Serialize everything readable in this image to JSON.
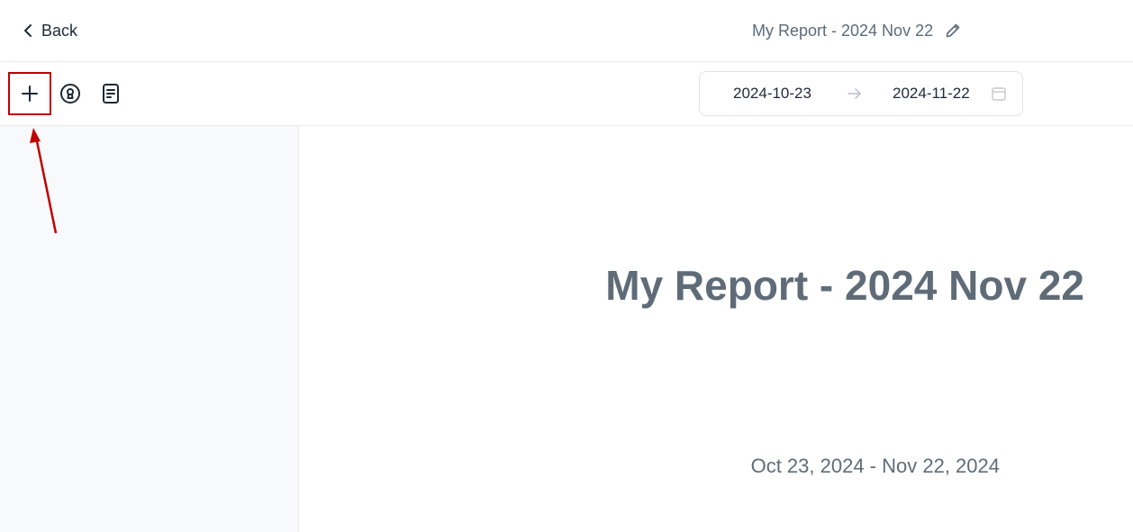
{
  "header": {
    "back_label": "Back",
    "report_title": "My Report - 2024 Nov 22"
  },
  "toolbar": {
    "tools": [
      {
        "name": "add",
        "icon": "plus-icon"
      },
      {
        "name": "lock",
        "icon": "keyhole-circle-icon"
      },
      {
        "name": "doc",
        "icon": "document-icon"
      }
    ],
    "date_start": "2024-10-23",
    "date_end": "2024-11-22",
    "range_arrow_icon": "arrow-right-icon",
    "calendar_icon": "calendar-icon"
  },
  "report": {
    "title": "My Report - 2024 Nov 22",
    "date_range": "Oct 23, 2024 - Nov 22, 2024"
  },
  "colors": {
    "highlight": "#c00000",
    "title_text": "#5f6c78",
    "sidebar_bg": "#f8f9fb"
  }
}
